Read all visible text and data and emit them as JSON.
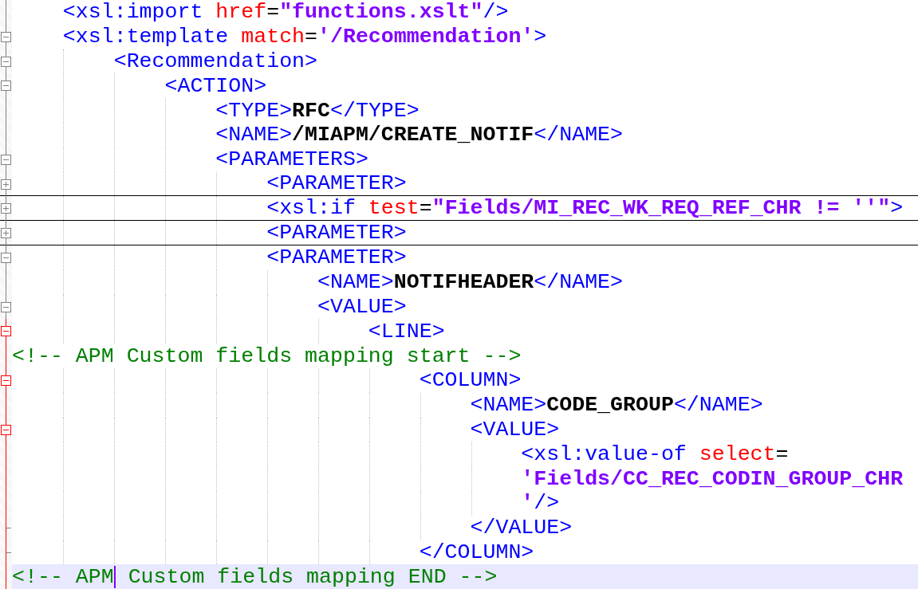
{
  "editor": {
    "lines": [
      {
        "fold": {
          "kind": "line",
          "highlighted": false
        },
        "folded": false,
        "current": false,
        "tokens": [
          {
            "kind": "tag",
            "text": "    <xsl:import "
          },
          {
            "kind": "attr",
            "text": "href"
          },
          {
            "kind": "plain",
            "text": "="
          },
          {
            "kind": "value",
            "text": "\"functions.xslt\""
          },
          {
            "kind": "tag",
            "text": "/>"
          }
        ]
      },
      {
        "fold": {
          "kind": "collapse",
          "highlighted": false
        },
        "folded": false,
        "current": false,
        "tokens": [
          {
            "kind": "tag",
            "text": "    <xsl:template "
          },
          {
            "kind": "attr",
            "text": "match"
          },
          {
            "kind": "plain",
            "text": "="
          },
          {
            "kind": "value",
            "text": "'/Recommendation'"
          },
          {
            "kind": "tag",
            "text": ">"
          }
        ]
      },
      {
        "fold": {
          "kind": "collapse",
          "highlighted": false
        },
        "folded": false,
        "current": false,
        "tokens": [
          {
            "kind": "tag",
            "text": "        <Recommendation>"
          }
        ]
      },
      {
        "fold": {
          "kind": "collapse",
          "highlighted": false
        },
        "folded": false,
        "current": false,
        "tokens": [
          {
            "kind": "tag",
            "text": "            <ACTION>"
          }
        ]
      },
      {
        "fold": {
          "kind": "line",
          "highlighted": false
        },
        "folded": false,
        "current": false,
        "tokens": [
          {
            "kind": "tag",
            "text": "                <TYPE>"
          },
          {
            "kind": "text",
            "text": "RFC"
          },
          {
            "kind": "tag",
            "text": "</TYPE>"
          }
        ]
      },
      {
        "fold": {
          "kind": "line",
          "highlighted": false
        },
        "folded": false,
        "current": false,
        "tokens": [
          {
            "kind": "tag",
            "text": "                <NAME>"
          },
          {
            "kind": "text",
            "text": "/MIAPM/CREATE_NOTIF"
          },
          {
            "kind": "tag",
            "text": "</NAME>"
          }
        ]
      },
      {
        "fold": {
          "kind": "collapse",
          "highlighted": false
        },
        "folded": false,
        "current": false,
        "tokens": [
          {
            "kind": "tag",
            "text": "                <PARAMETERS>"
          }
        ]
      },
      {
        "fold": {
          "kind": "expand",
          "highlighted": false
        },
        "folded": true,
        "current": false,
        "tokens": [
          {
            "kind": "tag",
            "text": "                    <PARAMETER>"
          }
        ]
      },
      {
        "fold": {
          "kind": "expand",
          "highlighted": false
        },
        "folded": true,
        "current": false,
        "tokens": [
          {
            "kind": "tag",
            "text": "                    <xsl:if "
          },
          {
            "kind": "attr",
            "text": "test"
          },
          {
            "kind": "plain",
            "text": "="
          },
          {
            "kind": "value",
            "text": "\"Fields/MI_REC_WK_REQ_REF_CHR != ''\""
          },
          {
            "kind": "tag",
            "text": ">"
          }
        ]
      },
      {
        "fold": {
          "kind": "expand",
          "highlighted": false
        },
        "folded": true,
        "current": false,
        "tokens": [
          {
            "kind": "tag",
            "text": "                    <PARAMETER>"
          }
        ]
      },
      {
        "fold": {
          "kind": "collapse",
          "highlighted": false
        },
        "folded": false,
        "current": false,
        "tokens": [
          {
            "kind": "tag",
            "text": "                    <PARAMETER>"
          }
        ]
      },
      {
        "fold": {
          "kind": "line",
          "highlighted": false
        },
        "folded": false,
        "current": false,
        "tokens": [
          {
            "kind": "tag",
            "text": "                        <NAME>"
          },
          {
            "kind": "text",
            "text": "NOTIFHEADER"
          },
          {
            "kind": "tag",
            "text": "</NAME>"
          }
        ]
      },
      {
        "fold": {
          "kind": "collapse",
          "highlighted": false
        },
        "folded": false,
        "current": false,
        "tokens": [
          {
            "kind": "tag",
            "text": "                        <VALUE>"
          }
        ]
      },
      {
        "fold": {
          "kind": "collapse",
          "highlighted": true
        },
        "folded": false,
        "current": false,
        "tokens": [
          {
            "kind": "tag",
            "text": "                            <LINE>"
          }
        ]
      },
      {
        "fold": {
          "kind": "line",
          "highlighted": true
        },
        "folded": false,
        "current": false,
        "tokens": [
          {
            "kind": "comment",
            "text": "<!-- APM Custom fields mapping start -->"
          }
        ]
      },
      {
        "fold": {
          "kind": "collapse",
          "highlighted": true
        },
        "folded": false,
        "current": false,
        "tokens": [
          {
            "kind": "tag",
            "text": "                                <COLUMN>"
          }
        ]
      },
      {
        "fold": {
          "kind": "line",
          "highlighted": true
        },
        "folded": false,
        "current": false,
        "tokens": [
          {
            "kind": "tag",
            "text": "                                    <NAME>"
          },
          {
            "kind": "text",
            "text": "CODE_GROUP"
          },
          {
            "kind": "tag",
            "text": "</NAME>"
          }
        ]
      },
      {
        "fold": {
          "kind": "collapse",
          "highlighted": true
        },
        "folded": false,
        "current": false,
        "tokens": [
          {
            "kind": "tag",
            "text": "                                    <VALUE>"
          }
        ]
      },
      {
        "fold": {
          "kind": "line",
          "highlighted": true
        },
        "folded": false,
        "current": false,
        "tokens": [
          {
            "kind": "tag",
            "text": "                                        <xsl:value-of "
          },
          {
            "kind": "attr",
            "text": "select"
          },
          {
            "kind": "plain",
            "text": "="
          }
        ]
      },
      {
        "fold": {
          "kind": "line",
          "highlighted": true
        },
        "folded": false,
        "current": false,
        "tokens": [
          {
            "kind": "value",
            "text": "                                        'Fields/CC_REC_CODIN_GROUP_CHR"
          }
        ]
      },
      {
        "fold": {
          "kind": "line",
          "highlighted": true
        },
        "folded": false,
        "current": false,
        "tokens": [
          {
            "kind": "value",
            "text": "                                        '"
          },
          {
            "kind": "tag",
            "text": "/>"
          }
        ]
      },
      {
        "fold": {
          "kind": "end",
          "highlighted": true
        },
        "folded": false,
        "current": false,
        "tokens": [
          {
            "kind": "tag",
            "text": "                                    </VALUE>"
          }
        ]
      },
      {
        "fold": {
          "kind": "end",
          "highlighted": true
        },
        "folded": false,
        "current": false,
        "tokens": [
          {
            "kind": "tag",
            "text": "                                </COLUMN>"
          }
        ]
      },
      {
        "fold": {
          "kind": "line",
          "highlighted": true
        },
        "folded": false,
        "current": true,
        "tokens": [
          {
            "kind": "comment",
            "text": "<!-- APM",
            "caret_after": true
          },
          {
            "kind": "comment",
            "text": " Custom fields mapping END -->"
          }
        ]
      }
    ]
  }
}
